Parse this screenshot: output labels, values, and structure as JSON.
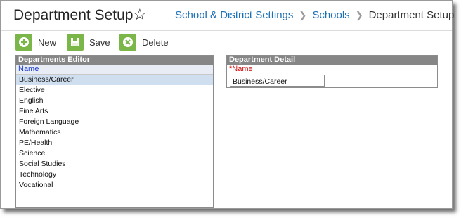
{
  "header": {
    "title": "Department Setup",
    "breadcrumb": [
      "School & District Settings",
      "Schools",
      "Department Setup"
    ]
  },
  "toolbar": {
    "new_label": "New",
    "save_label": "Save",
    "delete_label": "Delete",
    "icon_color": "#7ab648"
  },
  "editor": {
    "title": "Departments Editor",
    "column": "Name",
    "items": [
      "Business/Career",
      "Elective",
      "English",
      "Fine Arts",
      "Foreign Language",
      "Mathematics",
      "PE/Health",
      "Science",
      "Social Studies",
      "Technology",
      "Vocational"
    ],
    "selected_index": 0
  },
  "detail": {
    "title": "Department Detail",
    "name_label": "*Name",
    "name_value": "Business/Career"
  }
}
